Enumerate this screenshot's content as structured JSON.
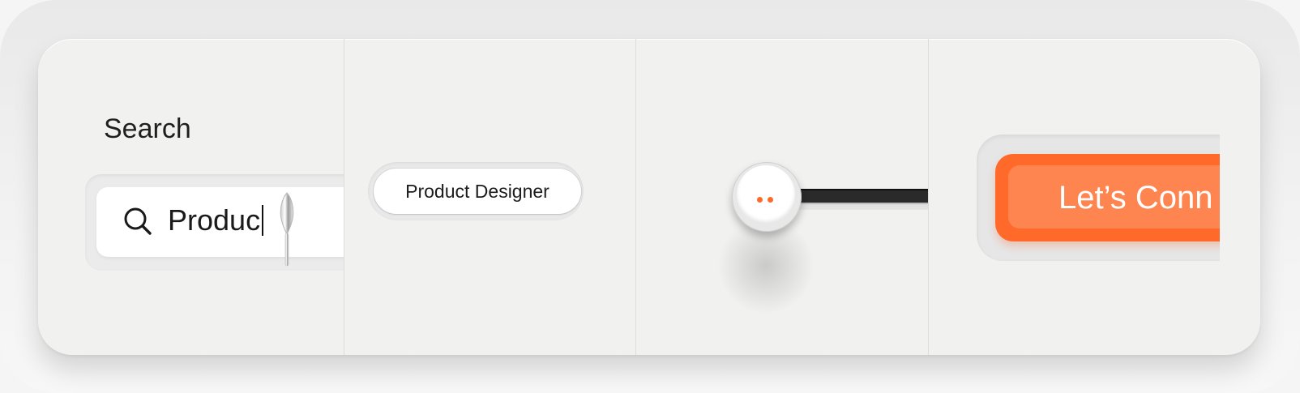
{
  "search": {
    "label": "Search",
    "value": "Produc",
    "icon": "search-icon"
  },
  "chip": {
    "label": "Product Designer"
  },
  "slider": {
    "accent": "#ff6a2b",
    "track_color": "#2a2a2a"
  },
  "cta": {
    "label": "Let’s Conn",
    "color": "#ff6a2b"
  }
}
